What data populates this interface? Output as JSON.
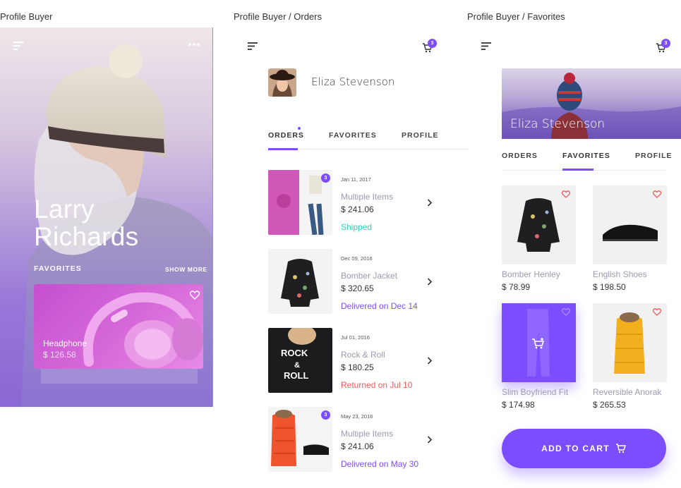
{
  "captions": [
    "Profile Buyer",
    "Profile Buyer / Orders",
    "Profile Buyer / Favorites"
  ],
  "colors": {
    "accent": "#7c4dff",
    "shipped": "#2fd1b7",
    "delivered": "#7c4dff",
    "returned": "#f25a5a"
  },
  "profile": {
    "first_name": "Larry",
    "last_name": "Richards",
    "favorites_label": "FAVORITES",
    "show_more": "SHOW MORE",
    "card": {
      "title": "Headphone",
      "price": "$ 126.58"
    },
    "icons": [
      "menu-icon",
      "more-icon",
      "heart-icon"
    ]
  },
  "orders_screen": {
    "cart_count": "3",
    "user_name": "Eliza Stevenson",
    "tabs": [
      "ORDERS",
      "FAVORITES",
      "PROFILE"
    ],
    "active_tab": "ORDERS",
    "orders": [
      {
        "date": "Jan 11, 2017",
        "item": "Multiple Items",
        "price": "$ 241.06",
        "status": "Shipped",
        "badge": "3"
      },
      {
        "date": "Dec 09, 2016",
        "item": "Bomber Jacket",
        "price": "$ 320.65",
        "status": "Delivered on Dec 14"
      },
      {
        "date": "Jul 01, 2016",
        "item": "Rock & Roll",
        "price": "$ 180.25",
        "status": "Returned on Jul 10"
      },
      {
        "date": "May 23, 2016",
        "item": "Multiple Items",
        "price": "$ 241.06",
        "status": "Delivered on May 30",
        "badge": "3"
      }
    ]
  },
  "favorites_screen": {
    "cart_count": "3",
    "user_name": "Eliza Stevenson",
    "tabs": [
      "ORDERS",
      "FAVORITES",
      "PROFILE"
    ],
    "active_tab": "FAVORITES",
    "products": [
      {
        "name": "Bomber Henley",
        "price": "$ 78.99"
      },
      {
        "name": "English Shoes",
        "price": "$ 198.50"
      },
      {
        "name": "Slim Boyfriend Fit",
        "price": "$ 174.98"
      },
      {
        "name": "Reversible Anorak",
        "price": "$ 265.53"
      }
    ],
    "add_to_cart": "ADD TO CART"
  }
}
